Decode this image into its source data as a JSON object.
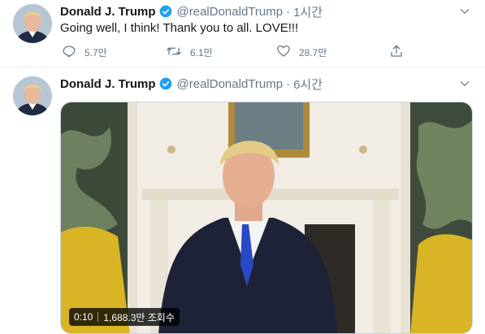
{
  "tweets": [
    {
      "name": "Donald J. Trump",
      "handle": "@realDonaldTrump",
      "separator": "·",
      "time": "1시간",
      "text": "Going well, I think! Thank you to all. LOVE!!!",
      "replies": "5.7만",
      "retweets": "6.1만",
      "likes": "28.7만"
    },
    {
      "name": "Donald J. Trump",
      "handle": "@realDonaldTrump",
      "separator": "·",
      "time": "6시간",
      "video": {
        "duration": "0:10",
        "views": "1,688.3만 조회수"
      }
    }
  ],
  "colors": {
    "verified": "#1da1f2",
    "secondary_text": "#657786",
    "divider": "#e6ecf0"
  },
  "icons": [
    "verified-badge-icon",
    "chevron-down-icon",
    "reply-icon",
    "retweet-icon",
    "like-icon",
    "share-icon"
  ]
}
